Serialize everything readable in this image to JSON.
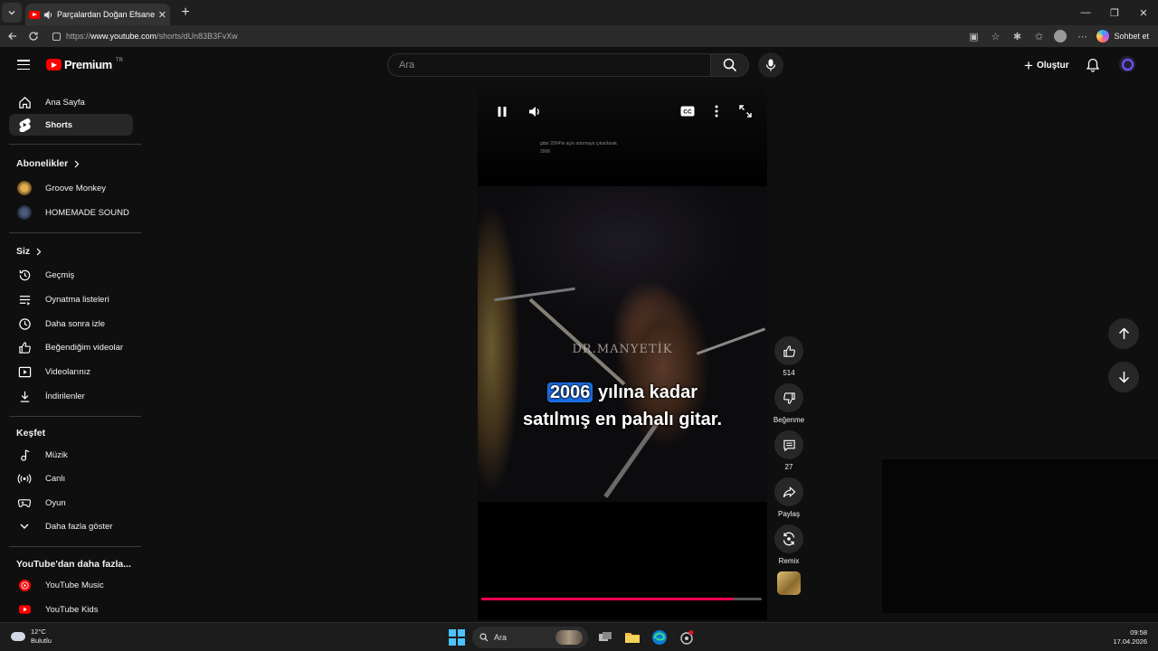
{
  "browser": {
    "tab_title": "Parçalardan Doğan Efsane: Gi",
    "url": "https://www.youtube.com/shorts/dUn83B3FvXw",
    "url_prefix": "https://",
    "url_host": "www.youtube.com",
    "url_path": "/shorts/dUn83B3FvXw",
    "copilot_label": "Sohbet et"
  },
  "header": {
    "logo_text": "Premium",
    "logo_sup": "TR",
    "search_placeholder": "Ara",
    "create_label": "Oluştur"
  },
  "sidebar": {
    "main": [
      {
        "label": "Ana Sayfa",
        "icon": "home-icon"
      },
      {
        "label": "Shorts",
        "icon": "shorts-icon",
        "active": true
      }
    ],
    "subscriptions_title": "Abonelikler",
    "subscriptions": [
      {
        "label": "Groove Monkey"
      },
      {
        "label": "HOMEMADE SOUND"
      }
    ],
    "you_title": "Siz",
    "you": [
      {
        "label": "Geçmiş",
        "icon": "history-icon"
      },
      {
        "label": "Oynatma listeleri",
        "icon": "playlists-icon"
      },
      {
        "label": "Daha sonra izle",
        "icon": "watch-later-icon"
      },
      {
        "label": "Beğendiğim videolar",
        "icon": "liked-icon"
      },
      {
        "label": "Videolarınız",
        "icon": "your-videos-icon"
      },
      {
        "label": "İndirilenler",
        "icon": "downloads-icon"
      }
    ],
    "explore_title": "Keşfet",
    "explore": [
      {
        "label": "Müzik",
        "icon": "music-icon"
      },
      {
        "label": "Canlı",
        "icon": "live-icon"
      },
      {
        "label": "Oyun",
        "icon": "gaming-icon"
      },
      {
        "label": "Daha fazla göster",
        "icon": "chevron-down-icon"
      }
    ],
    "more_title": "YouTube'dan daha fazla...",
    "more": [
      {
        "label": "YouTube Music"
      },
      {
        "label": "YouTube Kids"
      }
    ]
  },
  "player": {
    "small_text_line1": "gitar 2004'te açık artırmaya çıkarılarak",
    "small_text_line2": "2006",
    "watermark": "DR.MANYETİK",
    "caption_highlight": "2006",
    "caption_line1_rest": " yılına kadar",
    "caption_line2": "satılmış en pahalı gitar.",
    "progress": 0.9
  },
  "actions": {
    "likes": "514",
    "dislike_label": "Beğenme",
    "comments": "27",
    "share_label": "Paylaş",
    "remix_label": "Remix"
  },
  "taskbar": {
    "temp": "12°C",
    "weather": "Bulutlu",
    "search_label": "Ara",
    "time": "09:58",
    "date": "17.04.2026"
  },
  "colors": {
    "accent_red": "#ff0000",
    "progress_pink": "#ff0050",
    "caption_highlight": "#1b6fe6"
  }
}
